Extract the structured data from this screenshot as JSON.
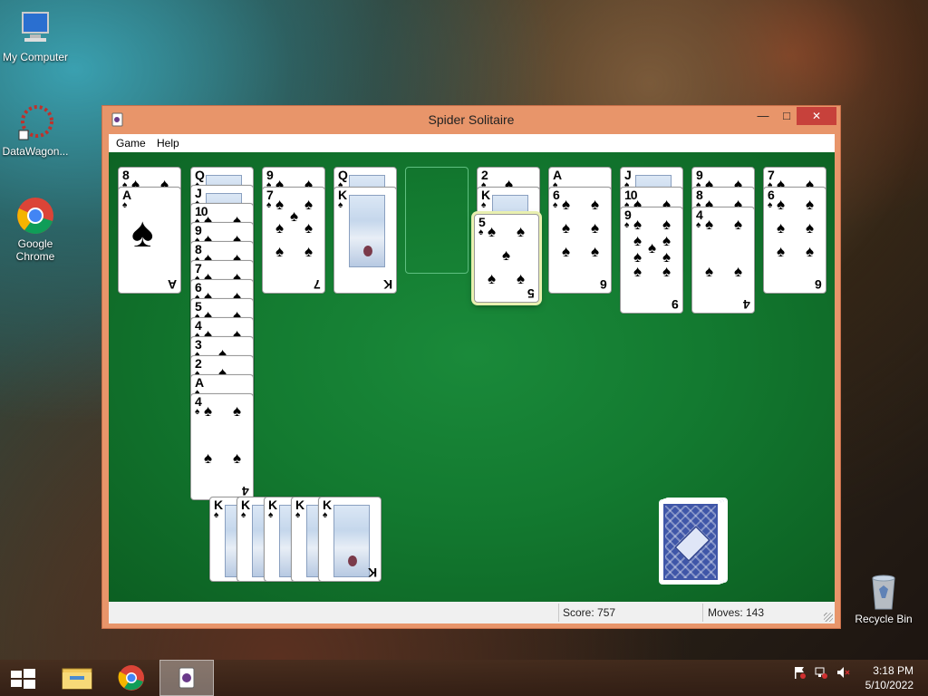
{
  "desktop": {
    "icons": [
      {
        "label": "My Computer"
      },
      {
        "label": "DataWagon..."
      },
      {
        "label": "Google Chrome"
      },
      {
        "label": "Recycle Bin"
      }
    ]
  },
  "window": {
    "title": "Spider Solitaire",
    "minimize_glyph": "—",
    "maximize_glyph": "□",
    "close_glyph": "✕",
    "menu": [
      "Game",
      "Help"
    ],
    "status": {
      "score_label": "Score: 757",
      "moves_label": "Moves:  143"
    }
  },
  "game": {
    "suit_glyph": "♠",
    "tableau": [
      {
        "ranks": [
          "8",
          "A"
        ]
      },
      {
        "ranks": [
          "Q",
          "J",
          "10",
          "9",
          "8",
          "7",
          "6",
          "5",
          "4",
          "3",
          "2",
          "A",
          "4"
        ]
      },
      {
        "ranks": [
          "9",
          "7"
        ]
      },
      {
        "ranks": [
          "Q",
          "K"
        ]
      },
      {
        "ranks": []
      },
      {
        "ranks": [
          "2",
          "K",
          "5"
        ]
      },
      {
        "ranks": [
          "A",
          "6"
        ]
      },
      {
        "ranks": [
          "J",
          "10",
          "9"
        ]
      },
      {
        "ranks": [
          "9",
          "8",
          "4"
        ]
      },
      {
        "ranks": [
          "7",
          "6"
        ]
      }
    ],
    "completed_sequences": [
      "K",
      "K",
      "K",
      "K",
      "K"
    ],
    "stock_label": ""
  },
  "taskbar": {
    "clock_time": "3:18 PM",
    "clock_date": "5/10/2022"
  },
  "colors": {
    "felt": "#137a30",
    "window_frame": "#e8956a",
    "close_button": "#c7413b",
    "card_back": "#3f56a8"
  }
}
